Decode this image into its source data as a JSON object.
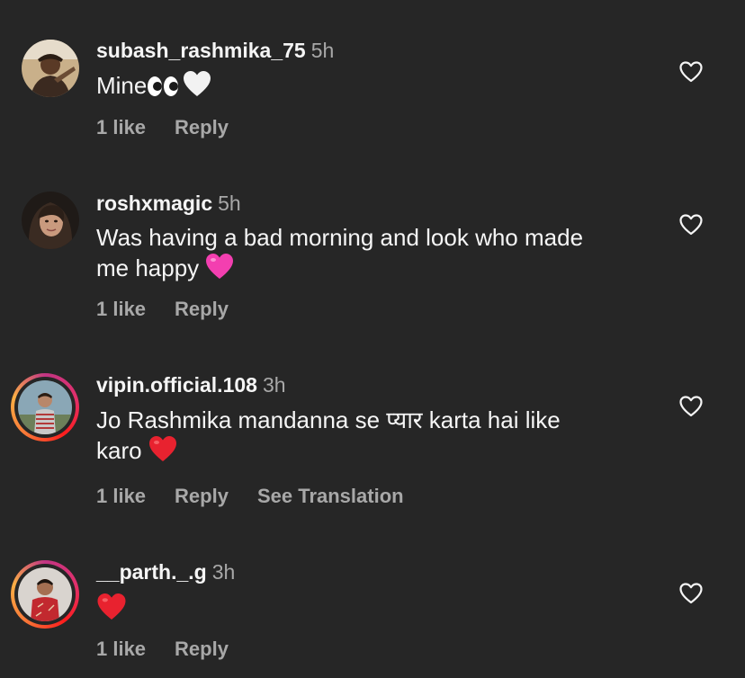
{
  "comments": [
    {
      "username": "subash_rashmika_75",
      "time": "5h",
      "text_line1": "Mine",
      "text_line2": "",
      "likes": "1 like",
      "reply": "Reply",
      "translate": ""
    },
    {
      "username": "roshxmagic",
      "time": "5h",
      "text_line1": "Was having a bad morning and look who made",
      "text_line2": "me happy",
      "likes": "1 like",
      "reply": "Reply",
      "translate": ""
    },
    {
      "username": "vipin.official.108",
      "time": "3h",
      "text_line1": "Jo Rashmika mandanna se प्यार karta hai like",
      "text_line2": "karo",
      "likes": "1 like",
      "reply": "Reply",
      "translate": "See Translation"
    },
    {
      "username": "__parth._.g",
      "time": "3h",
      "text_line1": "",
      "text_line2": "",
      "likes": "1 like",
      "reply": "Reply",
      "translate": ""
    }
  ],
  "colors": {
    "background": "#262626",
    "primary_text": "#f5f5f5",
    "secondary_text": "#a8a8a8",
    "heart_red": "#e8222f",
    "heart_pink": "#f33fb0"
  },
  "icons": {
    "like": "heart-outline-icon",
    "eyes": "eyes-emoji",
    "white_heart": "white-heart-emoji",
    "pink_heart": "pink-heart-emoji",
    "red_heart": "red-heart-emoji"
  }
}
